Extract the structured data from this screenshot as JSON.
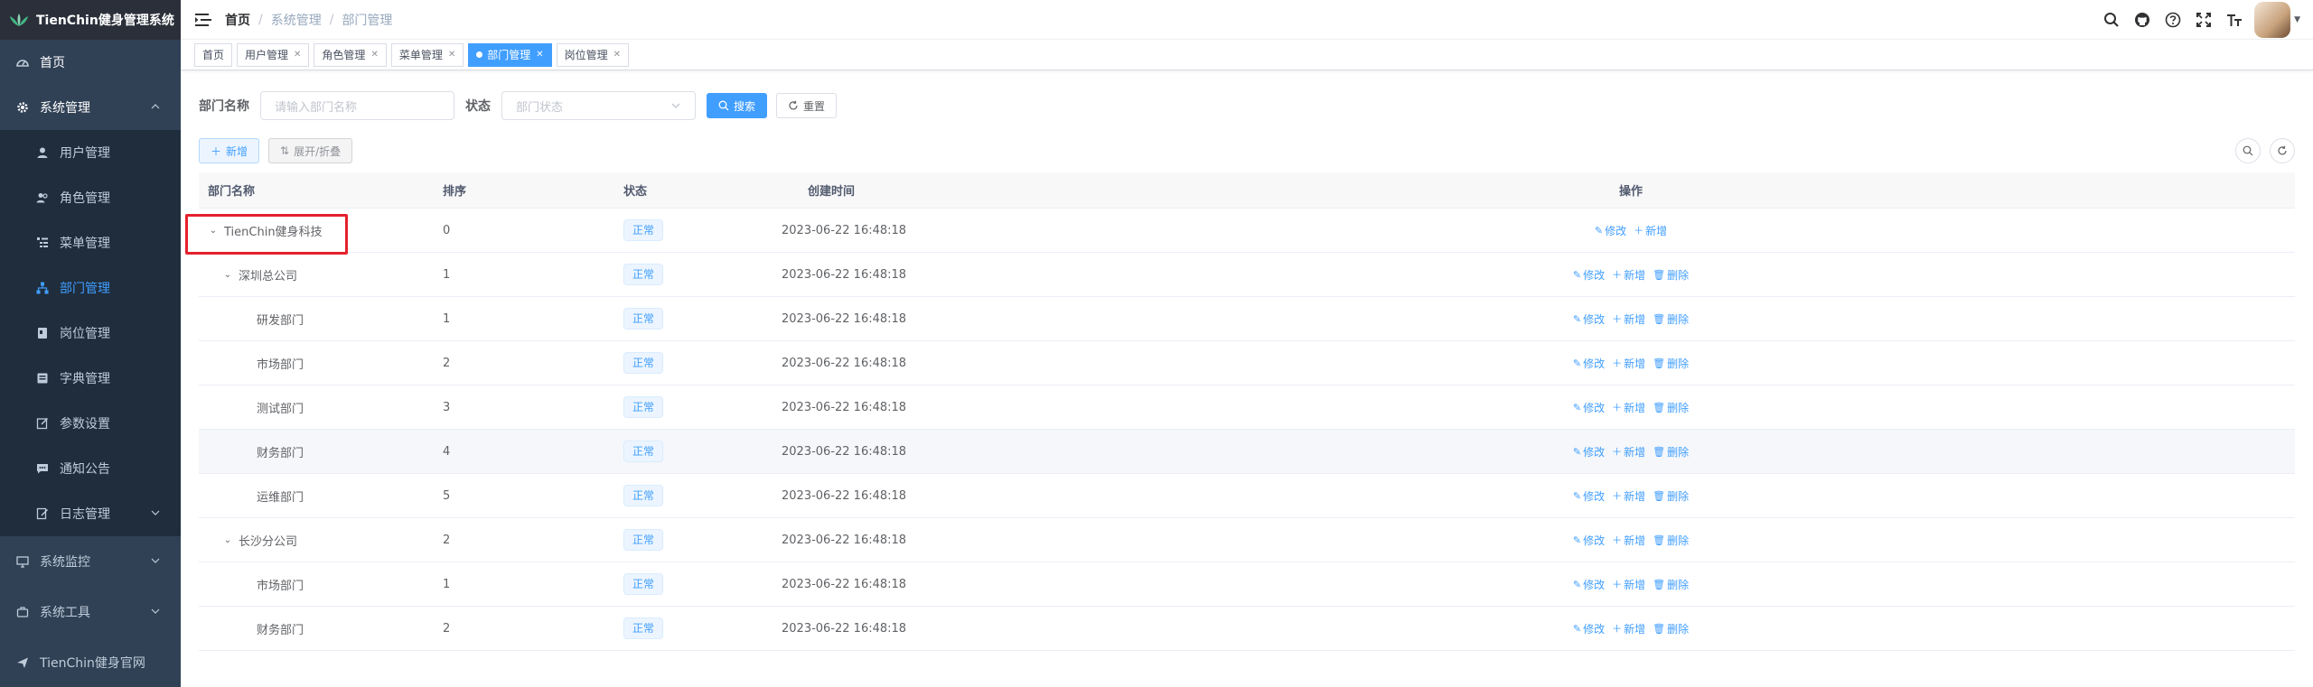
{
  "app": {
    "title": "TienChin健身管理系统"
  },
  "sidebar": {
    "items": [
      {
        "label": "首页",
        "icon": "dashboard-icon"
      },
      {
        "label": "系统管理",
        "icon": "gear-icon"
      },
      {
        "label": "系统监控",
        "icon": "monitor-icon"
      },
      {
        "label": "系统工具",
        "icon": "tool-icon"
      },
      {
        "label": "TienChin健身官网",
        "icon": "send-icon"
      }
    ],
    "submenu": [
      {
        "label": "用户管理",
        "icon": "user-icon"
      },
      {
        "label": "角色管理",
        "icon": "peoples-icon"
      },
      {
        "label": "菜单管理",
        "icon": "tree-table-icon"
      },
      {
        "label": "部门管理",
        "icon": "tree-icon"
      },
      {
        "label": "岗位管理",
        "icon": "post-icon"
      },
      {
        "label": "字典管理",
        "icon": "dict-icon"
      },
      {
        "label": "参数设置",
        "icon": "edit-icon"
      },
      {
        "label": "通知公告",
        "icon": "message-icon"
      },
      {
        "label": "日志管理",
        "icon": "log-icon"
      }
    ]
  },
  "breadcrumb": [
    "首页",
    "系统管理",
    "部门管理"
  ],
  "tags": [
    {
      "label": "首页",
      "closable": false,
      "active": false
    },
    {
      "label": "用户管理",
      "closable": true,
      "active": false
    },
    {
      "label": "角色管理",
      "closable": true,
      "active": false
    },
    {
      "label": "菜单管理",
      "closable": true,
      "active": false
    },
    {
      "label": "部门管理",
      "closable": true,
      "active": true
    },
    {
      "label": "岗位管理",
      "closable": true,
      "active": false
    }
  ],
  "search": {
    "dept_label": "部门名称",
    "dept_placeholder": "请输入部门名称",
    "status_label": "状态",
    "status_placeholder": "部门状态",
    "search_button": "搜索",
    "reset_button": "重置"
  },
  "actions": {
    "add": "新增",
    "expand": "展开/折叠"
  },
  "table": {
    "columns": [
      "部门名称",
      "排序",
      "状态",
      "创建时间",
      "操作"
    ],
    "op_labels": {
      "edit": "修改",
      "add": "新增",
      "delete": "删除"
    },
    "rows": [
      {
        "name": "TienChin健身科技",
        "sort": "0",
        "status": "正常",
        "time": "2023-06-22 16:48:18",
        "level": 0,
        "expandable": true,
        "deletable": false
      },
      {
        "name": "深圳总公司",
        "sort": "1",
        "status": "正常",
        "time": "2023-06-22 16:48:18",
        "level": 1,
        "expandable": true,
        "deletable": true
      },
      {
        "name": "研发部门",
        "sort": "1",
        "status": "正常",
        "time": "2023-06-22 16:48:18",
        "level": 2,
        "expandable": false,
        "deletable": true
      },
      {
        "name": "市场部门",
        "sort": "2",
        "status": "正常",
        "time": "2023-06-22 16:48:18",
        "level": 2,
        "expandable": false,
        "deletable": true
      },
      {
        "name": "测试部门",
        "sort": "3",
        "status": "正常",
        "time": "2023-06-22 16:48:18",
        "level": 2,
        "expandable": false,
        "deletable": true
      },
      {
        "name": "财务部门",
        "sort": "4",
        "status": "正常",
        "time": "2023-06-22 16:48:18",
        "level": 2,
        "expandable": false,
        "deletable": true
      },
      {
        "name": "运维部门",
        "sort": "5",
        "status": "正常",
        "time": "2023-06-22 16:48:18",
        "level": 2,
        "expandable": false,
        "deletable": true
      },
      {
        "name": "长沙分公司",
        "sort": "2",
        "status": "正常",
        "time": "2023-06-22 16:48:18",
        "level": 1,
        "expandable": true,
        "deletable": true
      },
      {
        "name": "市场部门",
        "sort": "1",
        "status": "正常",
        "time": "2023-06-22 16:48:18",
        "level": 2,
        "expandable": false,
        "deletable": true
      },
      {
        "name": "财务部门",
        "sort": "2",
        "status": "正常",
        "time": "2023-06-22 16:48:18",
        "level": 2,
        "expandable": false,
        "deletable": true
      }
    ]
  },
  "colors": {
    "sidebar": "#304156",
    "submenu": "#1f2d3d",
    "primary": "#409eff",
    "highlight": "#e5212d"
  }
}
